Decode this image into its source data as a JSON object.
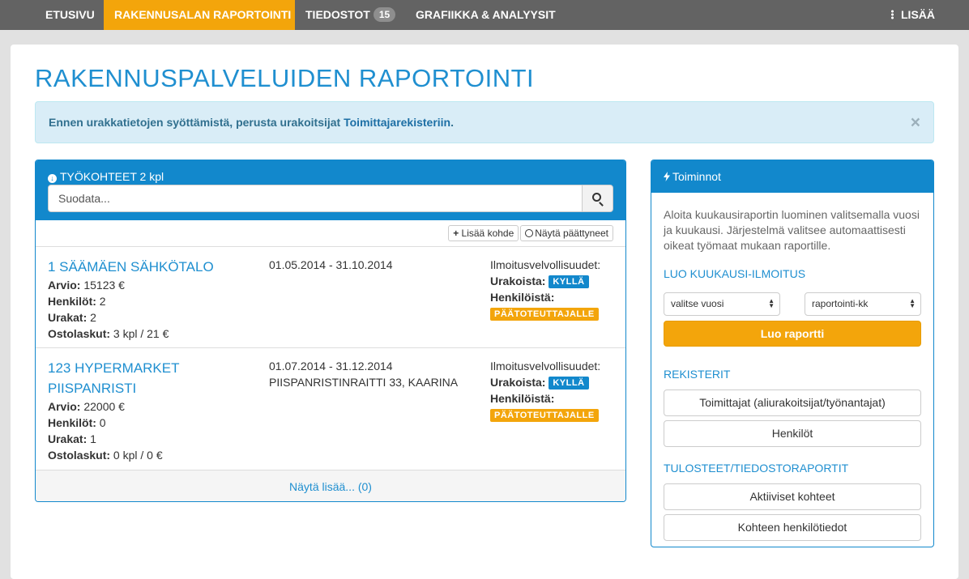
{
  "nav": {
    "home": "ETUSIVU",
    "reporting": "RAKENNUSALAN RAPORTOINTI",
    "files": "TIEDOSTOT",
    "files_count": "15",
    "graphics": "GRAFIIKKA & ANALYYSIT",
    "more": "LISÄÄ"
  },
  "page": {
    "title": "RAKENNUSPALVELUIDEN RAPORTOINTI"
  },
  "alert": {
    "text_before": "Ennen urakkatietojen syöttämistä, perusta urakoitsijat ",
    "link": "Toimittajarekisteriin",
    "text_after": ".",
    "close": "×"
  },
  "worksites": {
    "title": "TYÖKOHTEET 2 kpl",
    "search_placeholder": "Suodata...",
    "add_button": "Lisää kohde",
    "ended_button": "Näytä päättyneet",
    "labels": {
      "estimate": "Arvio:",
      "persons": "Henkilöt:",
      "contracts": "Urakat:",
      "invoices": "Ostolaskut:",
      "obligations": "Ilmoitusvelvollisuudet:",
      "contracts_obl": "Urakoista:",
      "persons_obl": "Henkilöistä:"
    },
    "items": [
      {
        "name": "1 SÄÄMÄEN SÄHKÖTALO",
        "estimate": " 15123 €",
        "persons": " 2",
        "contracts": " 2",
        "invoices": " 3 kpl / 21 €",
        "dates": "01.05.2014 - 31.10.2014",
        "address": "",
        "contracts_badge": "KYLLÄ",
        "persons_badge": "PÄÄTOTEUTTAJALLE"
      },
      {
        "name": "123 HYPERMARKET PIISPANRISTI",
        "estimate": " 22000 €",
        "persons": " 0",
        "contracts": " 1",
        "invoices": " 0 kpl / 0 €",
        "dates": "01.07.2014 - 31.12.2014",
        "address": "PIISPANRISTINRAITTI 33, KAARINA",
        "contracts_badge": "KYLLÄ",
        "persons_badge": "PÄÄTOTEUTTAJALLE"
      }
    ],
    "show_more": "Näytä lisää... (0)"
  },
  "actions": {
    "title": "Toiminnot",
    "intro": "Aloita kuukausiraportin luominen valitsemalla vuosi ja kuukausi. Järjestelmä valitsee automaattisesti oikeat työmaat mukaan raportille.",
    "monthly_heading": "LUO KUUKAUSI-ILMOITUS",
    "year_select": "valitse vuosi",
    "month_select": "raportointi-kk",
    "create_report": "Luo raportti",
    "registers_heading": "REKISTERIT",
    "suppliers_button": "Toimittajat (aliurakoitsijat/työnantajat)",
    "persons_button": "Henkilöt",
    "prints_heading": "TULOSTEET/TIEDOSTORAPORTIT",
    "active_sites_button": "Aktiiviset kohteet",
    "site_persons_button": "Kohteen henkilötiedot"
  },
  "colors": {
    "nav_bg": "#636363",
    "accent_orange": "#f3a50b",
    "primary_blue": "#1288cc"
  }
}
